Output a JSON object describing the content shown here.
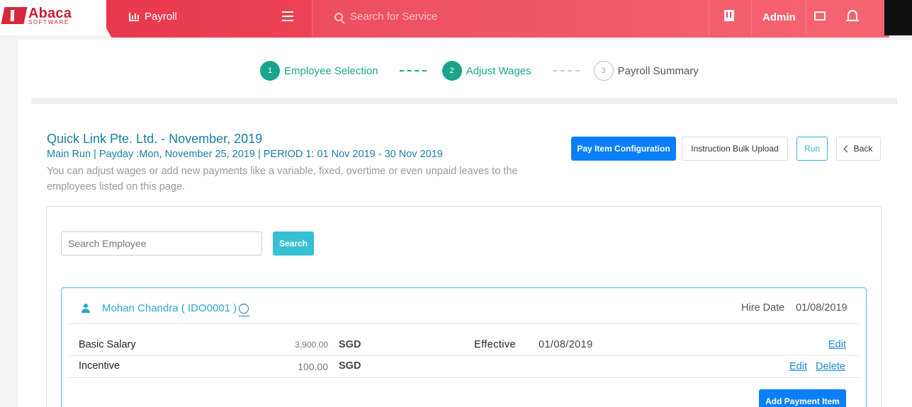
{
  "header": {
    "logo_name": "Abaca",
    "logo_sub": "SOFTWARE",
    "module": "Payroll",
    "search_placeholder": "Search for Service",
    "user": "Admin"
  },
  "stepper": [
    {
      "num": "1",
      "label": "Employee Selection"
    },
    {
      "num": "2",
      "label": "Adjust Wages"
    },
    {
      "num": "3",
      "label": "Payroll Summary"
    }
  ],
  "run": {
    "title": "Quick Link Pte. Ltd. - November, 2019",
    "subtitle": "Main Run |  Payday :Mon, November 25, 2019 |  PERIOD 1: 01 Nov 2019 - 30 Nov 2019",
    "description": "You can adjust wages or add new payments like a variable, fixed, overtime or even unpaid leaves to the employees listed on this page."
  },
  "actions": {
    "pay_item_config": "Pay Item Configuration",
    "bulk_upload": "Instruction Bulk Upload",
    "run": "Run",
    "back": "Back"
  },
  "search": {
    "placeholder": "Search Employee",
    "button": "Search"
  },
  "employee": {
    "name": "Mohan Chandra ( IDO0001 )",
    "hire_label": "Hire Date",
    "hire_date": "01/08/2019",
    "items": [
      {
        "name": "Basic Salary",
        "amount": "3,900.00",
        "currency": "SGD",
        "effective_label": "Effective",
        "effective_date": "01/08/2019",
        "edit": "Edit"
      },
      {
        "name": "Incentive",
        "amount": "100.00",
        "currency": "SGD",
        "edit": "Edit",
        "delete": "Delete"
      }
    ],
    "add_button": "Add Payment Item"
  },
  "colors": {
    "brand_red": "#e8374d",
    "accent_teal": "#1aa58b",
    "primary_blue": "#0a7ff7",
    "cyan": "#36c0d3"
  }
}
